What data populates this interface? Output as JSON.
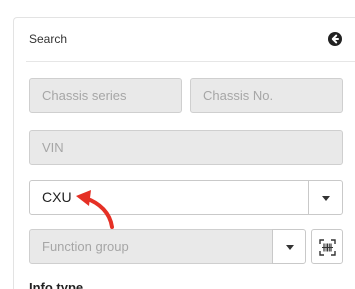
{
  "header": {
    "title": "Search"
  },
  "icons": {
    "back": "arrow-left-circle-icon",
    "scan": "barcode-scan-icon",
    "dropdown": "caret-down-icon"
  },
  "fields": {
    "chassis_series": {
      "placeholder": "Chassis series"
    },
    "chassis_no": {
      "placeholder": "Chassis No."
    },
    "vin": {
      "placeholder": "VIN"
    },
    "cxu": {
      "value": "CXU"
    },
    "function_group": {
      "placeholder": "Function group"
    }
  },
  "section": {
    "info_type_label": "Info type"
  },
  "annotation": {
    "arrow_color": "#e53025"
  }
}
